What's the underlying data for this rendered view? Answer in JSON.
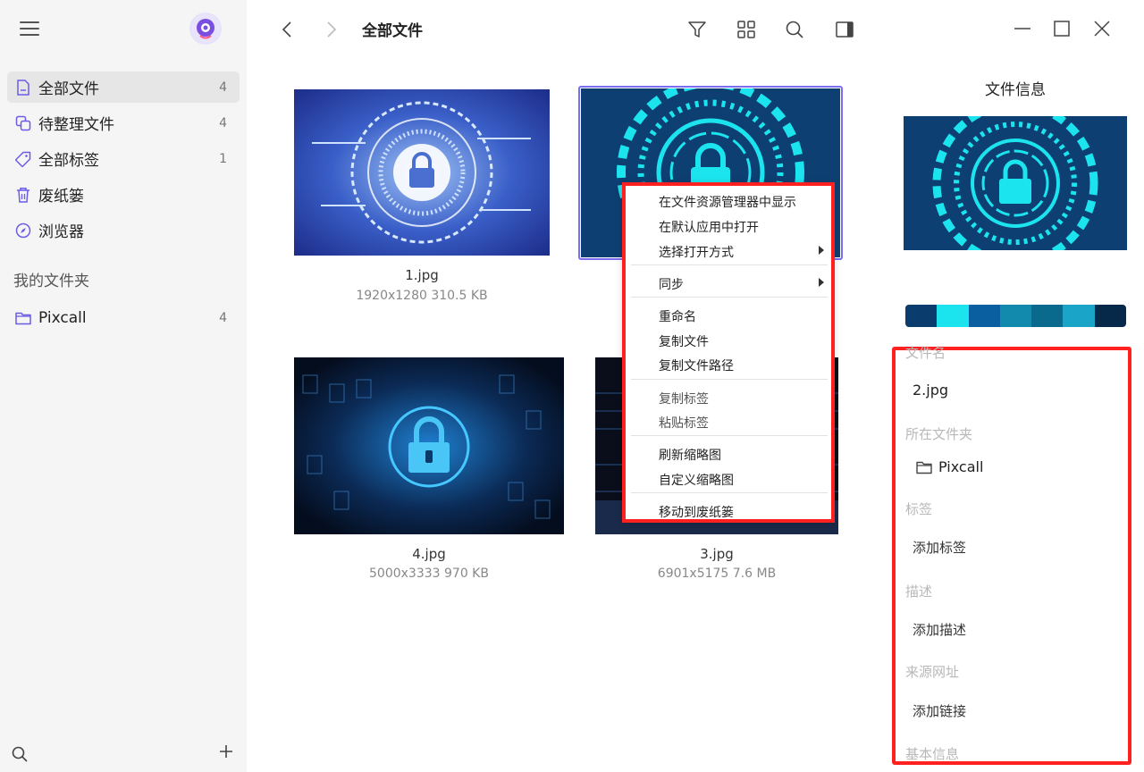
{
  "sidebar": {
    "nav": [
      {
        "label": "全部文件",
        "count": "4"
      },
      {
        "label": "待整理文件",
        "count": "4"
      },
      {
        "label": "全部标签",
        "count": "1"
      },
      {
        "label": "废纸篓",
        "count": ""
      },
      {
        "label": "浏览器",
        "count": ""
      }
    ],
    "section_title": "我的文件夹",
    "folders": [
      {
        "label": "Pixcall",
        "count": "4"
      }
    ]
  },
  "toolbar": {
    "title": "全部文件"
  },
  "files": [
    {
      "name": "1.jpg",
      "meta": "1920x1280   310.5 KB"
    },
    {
      "name": "2.jpg",
      "meta": ""
    },
    {
      "name": "4.jpg",
      "meta": "5000x3333   970 KB"
    },
    {
      "name": "3.jpg",
      "meta": "6901x5175   7.6 MB"
    }
  ],
  "context_menu": {
    "items": [
      "在文件资源管理器中显示",
      "在默认应用中打开",
      "选择打开方式",
      "同步",
      "重命名",
      "复制文件",
      "复制文件路径",
      "复制标签",
      "粘贴标签",
      "刷新缩略图",
      "自定义缩略图",
      "移动到废纸篓"
    ]
  },
  "info_panel": {
    "title": "文件信息",
    "palette": [
      "#0b3c6e",
      "#1ce4ee",
      "#0a5fa0",
      "#118aae",
      "#0a6a8e",
      "#1aa4c8",
      "#06294a"
    ],
    "filename_label": "文件名",
    "filename": "2.jpg",
    "folder_label": "所在文件夹",
    "folder": "Pixcall",
    "tags_label": "标签",
    "tags_action": "添加标签",
    "desc_label": "描述",
    "desc_action": "添加描述",
    "source_label": "来源网址",
    "source_action": "添加链接",
    "basic_label": "基本信息"
  },
  "colors": {
    "accent": "#7b6cf0",
    "highlight_red": "#ff2020"
  }
}
